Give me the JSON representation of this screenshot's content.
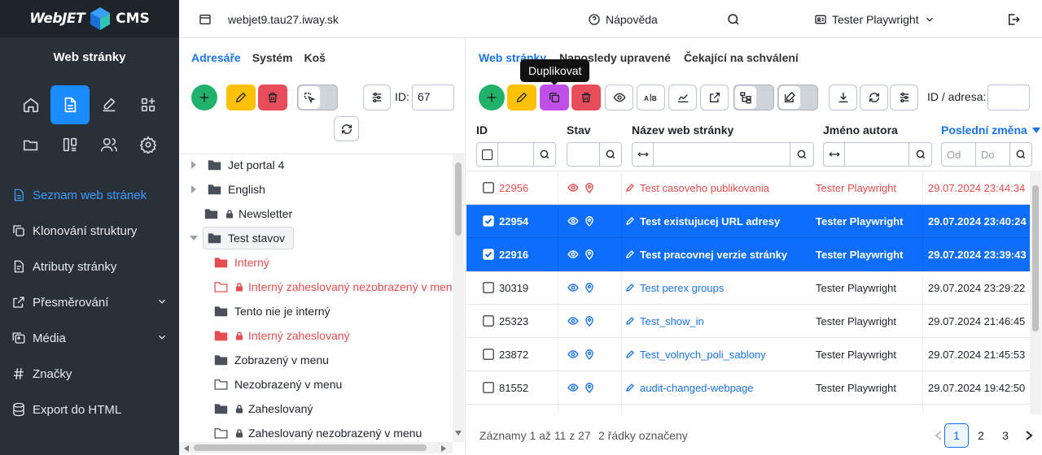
{
  "app": {
    "brand": "WebJET",
    "cms": "CMS",
    "section_title": "Web stránky"
  },
  "sidebar": {
    "nav": [
      {
        "label": "Seznam web stránek",
        "icon": "file-list-icon"
      },
      {
        "label": "Klonování struktury",
        "icon": "copy-icon"
      },
      {
        "label": "Atributy stránky",
        "icon": "file-attr-icon"
      },
      {
        "label": "Přesměrování",
        "icon": "redirect-icon"
      },
      {
        "label": "Média",
        "icon": "media-icon"
      },
      {
        "label": "Značky",
        "icon": "hash-icon"
      },
      {
        "label": "Export do HTML",
        "icon": "database-icon"
      }
    ]
  },
  "header": {
    "domain": "webjet9.tau27.iway.sk",
    "help": "Nápověda",
    "user": "Tester Playwright"
  },
  "tree": {
    "tabs": [
      "Adresáře",
      "Systém",
      "Koš"
    ],
    "id_label": "ID:",
    "id_value": "67",
    "items": [
      {
        "label": "Jet portal 4"
      },
      {
        "label": "English"
      },
      {
        "label": "Newsletter"
      },
      {
        "label": "Test stavov"
      },
      {
        "label": "Interný"
      },
      {
        "label": "Interný zaheslovaný nezobrazený v menu"
      },
      {
        "label": "Tento nie je interný"
      },
      {
        "label": "Interný zaheslovaný"
      },
      {
        "label": "Zobrazený v menu"
      },
      {
        "label": "Nezobrazený v menu"
      },
      {
        "label": "Zaheslovaný"
      },
      {
        "label": "Zaheslovaný nezobrazený v menu"
      }
    ]
  },
  "table": {
    "tabs": [
      "Web stránky",
      "Naposledy upravené",
      "Čekající na schválení"
    ],
    "tooltip": "Duplikovat",
    "search_label": "ID / adresa:",
    "columns": {
      "id": "ID",
      "status": "Stav",
      "title": "Název web stránky",
      "author": "Jméno autora",
      "modified": "Poslední změna"
    },
    "filter_placeholders": {
      "from": "Od",
      "to": "Do"
    },
    "rows": [
      {
        "id": "22956",
        "title": "Test casoveho publikovania",
        "author": "Tester Playwright",
        "date": "29.07.2024 23:44:34"
      },
      {
        "id": "22954",
        "title": "Test existujucej URL adresy",
        "author": "Tester Playwright",
        "date": "29.07.2024 23:40:24"
      },
      {
        "id": "22916",
        "title": "Test pracovnej verzie stránky",
        "author": "Tester Playwright",
        "date": "29.07.2024 23:39:43"
      },
      {
        "id": "30319",
        "title": "Test perex groups",
        "author": "Tester Playwright",
        "date": "29.07.2024 23:29:22"
      },
      {
        "id": "25323",
        "title": "Test_show_in",
        "author": "Tester Playwright",
        "date": "29.07.2024 21:46:45"
      },
      {
        "id": "23872",
        "title": "Test_volnych_poli_sablony",
        "author": "Tester Playwright",
        "date": "29.07.2024 21:45:53"
      },
      {
        "id": "81552",
        "title": "audit-changed-webpage",
        "author": "Tester Playwright",
        "date": "29.07.2024 19:42:50"
      }
    ],
    "footer": {
      "info": "Záznamy 1 až 11 z 27",
      "selected": "2 řádky označeny"
    },
    "pages": [
      "1",
      "2",
      "3"
    ]
  },
  "colors": {
    "sidebar": "#2a3038",
    "accent": "#0d6efd",
    "add": "#20b26b",
    "edit": "#ffc107",
    "delete": "#e84d5b",
    "duplicate": "#c04ee8"
  }
}
